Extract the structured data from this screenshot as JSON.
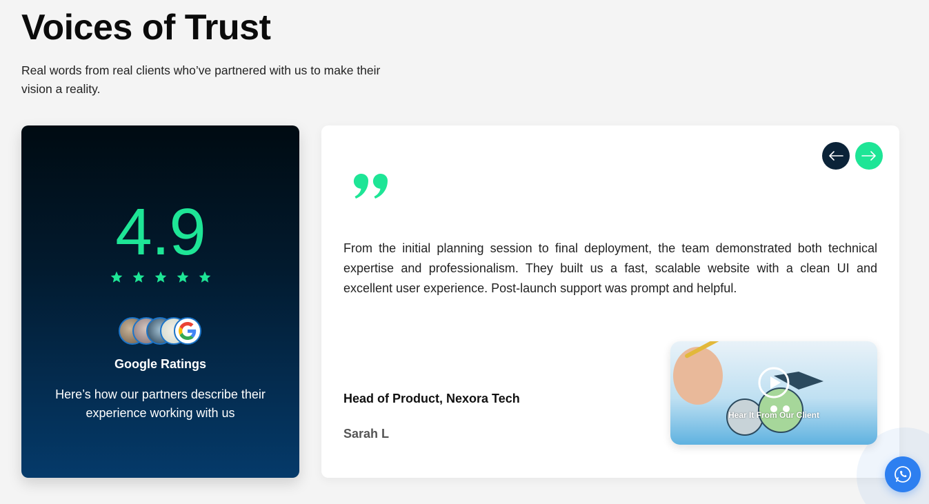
{
  "header": {
    "title": "Voices of Trust",
    "subtitle": "Real words from real clients who’ve partnered with us to make their vision a reality."
  },
  "rating_card": {
    "score": "4.9",
    "stars": 5,
    "source_label": "Google Ratings",
    "description": "Here’s how our partners describe their experience working with us",
    "accent_color": "#1ee596"
  },
  "testimonial": {
    "quote": "From the initial planning session to final deployment, the team demonstrated both technical expertise and professionalism. They built us a fast, scalable website with a clean UI and excellent user experience. Post-launch support was prompt and helpful.",
    "role": "Head of Product, Nexora Tech",
    "name": "Sarah L",
    "video_caption": "Hear It From Our Client"
  },
  "icons": {
    "prev": "arrow-left-icon",
    "next": "arrow-right-icon",
    "quote": "quote-icon",
    "play": "play-icon",
    "whatsapp": "whatsapp-icon"
  }
}
